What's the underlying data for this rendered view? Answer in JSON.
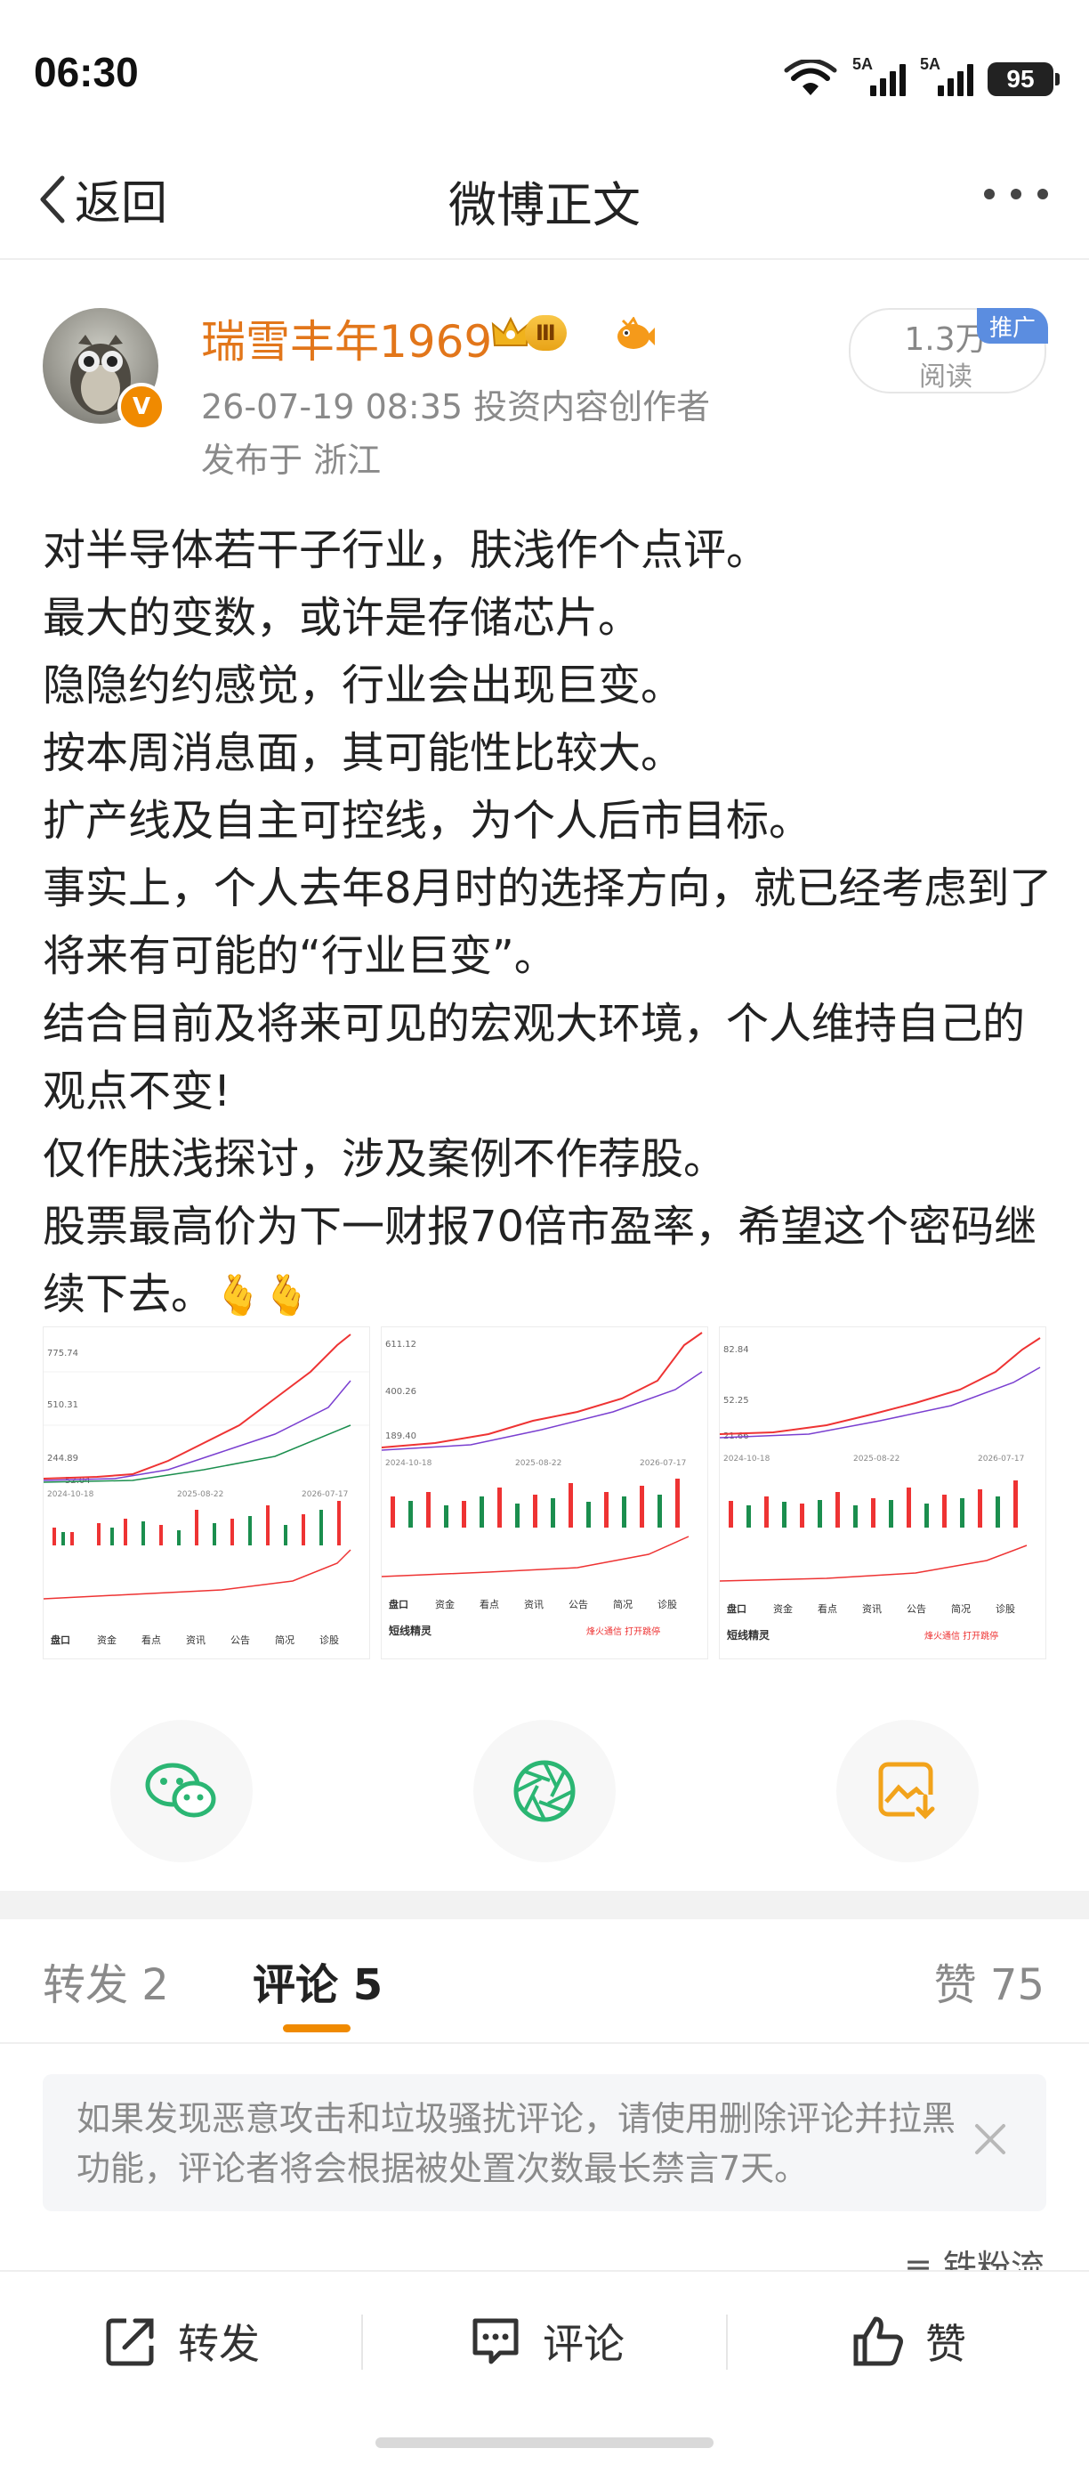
{
  "status_bar": {
    "time": "06:30",
    "net1": "5A",
    "net2": "5A",
    "battery": "95"
  },
  "nav": {
    "back_label": "返回",
    "title": "微博正文"
  },
  "author": {
    "name": "瑞雪丰年1969",
    "member_level": "Ⅲ",
    "meta_line": "26-07-19 08:35  投资内容创作者",
    "location": "发布于 浙江",
    "reads_count": "1.3万",
    "reads_label": "阅读",
    "promo_tag": "推广"
  },
  "post": {
    "lines": [
      "对半导体若干子行业，肤浅作个点评。",
      "最大的变数，或许是存储芯片。",
      "隐隐约约感觉，行业会出现巨变。",
      "按本周消息面，其可能性比较大。",
      "扩产线及自主可控线，为个人后市目标。",
      "事实上，个人去年8月时的选择方向，就已经考虑到了将来有可能的“行业巨变”。",
      "结合目前及将来可见的宏观大环境，个人维持自己的观点不变!",
      "仅作肤浅探讨，涉及案例不作荐股。",
      "股票最高价为下一财报70倍市盈率，希望这个密码继续下去。"
    ],
    "emoji": "🫰🫰"
  },
  "images": [
    {
      "prices": [
        "775.74",
        "510.31",
        "244.89",
        "52.04"
      ],
      "dates": [
        "2024-10-18",
        "2025-08-22",
        "2026-07-17"
      ],
      "tabs": [
        "盘口",
        "资金",
        "看点",
        "资讯",
        "公告",
        "简况",
        "诊股"
      ]
    },
    {
      "prices": [
        "611.12",
        "400.26",
        "189.40"
      ],
      "dates": [
        "2024-10-18",
        "2025-08-22",
        "2026-07-17"
      ],
      "tabs": [
        "盘口",
        "资金",
        "看点",
        "资讯",
        "公告",
        "简况",
        "诊股"
      ],
      "footer_left": "短线精灵",
      "footer_right": "烽火通信 打开跳停"
    },
    {
      "prices": [
        "82.84",
        "52.25",
        "21.66"
      ],
      "dates": [
        "2024-10-18",
        "2025-08-22",
        "2026-07-17"
      ],
      "tabs": [
        "盘口",
        "资金",
        "看点",
        "资讯",
        "公告",
        "简况",
        "诊股"
      ],
      "footer_left": "短线精灵",
      "footer_right": "烽火通信 打开跳停"
    }
  ],
  "tabs": {
    "repost": "转发 2",
    "comment": "评论 5",
    "like": "赞 75"
  },
  "notice": "如果发现恶意攻击和垃圾骚扰评论，请使用删除评论并拉黑功能，评论者将会根据被处置次数最长禁言7天。",
  "fans_sort": "铁粉流",
  "bottom_bar": {
    "repost": "转发",
    "comment": "评论",
    "like": "赞"
  }
}
